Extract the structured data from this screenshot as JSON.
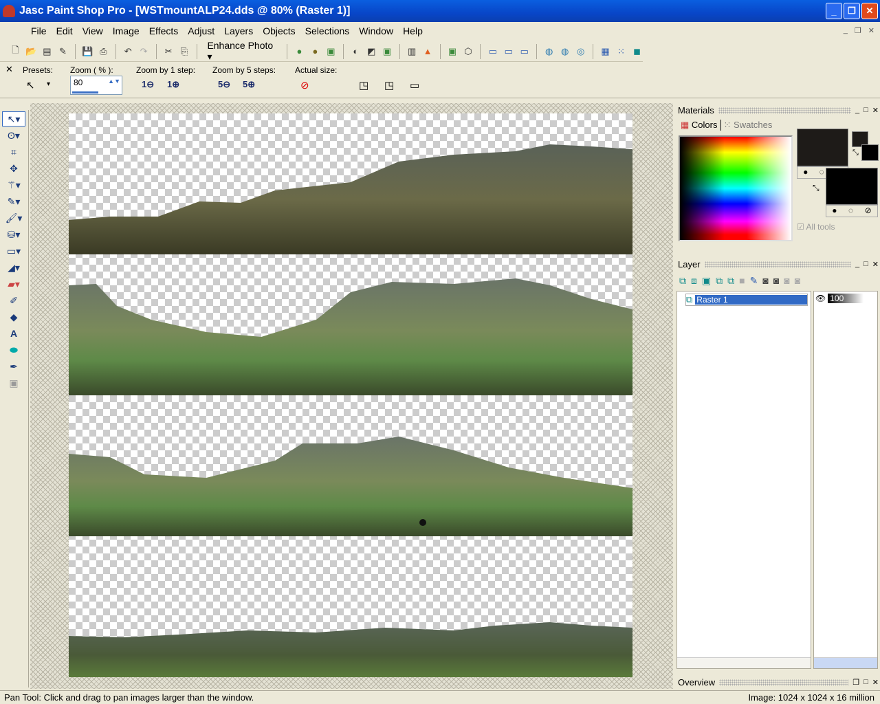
{
  "window": {
    "title": "Jasc Paint Shop Pro - [WSTmountALP24.dds @  80% (Raster 1)]"
  },
  "menu": [
    "File",
    "Edit",
    "View",
    "Image",
    "Effects",
    "Adjust",
    "Layers",
    "Objects",
    "Selections",
    "Window",
    "Help"
  ],
  "toolbar": {
    "enhance_photo": "Enhance Photo"
  },
  "tool_options": {
    "presets": "Presets:",
    "zoom_label": "Zoom ( % ):",
    "zoom_value": "80",
    "zoom1": "Zoom by 1 step:",
    "zoom5": "Zoom by 5 steps:",
    "actual": "Actual size:"
  },
  "materials": {
    "title": "Materials",
    "tab_colors": "Colors",
    "tab_swatches": "Swatches",
    "all_tools": "All tools",
    "foreground": "#1e1b18",
    "background": "#000000"
  },
  "layer": {
    "title": "Layer",
    "layers": [
      {
        "name": "Raster 1",
        "opacity": "100"
      }
    ]
  },
  "overview": {
    "title": "Overview"
  },
  "status": {
    "hint": "Pan Tool: Click and drag to pan images larger than the window.",
    "image_info": "Image:  1024 x 1024 x 16 million"
  }
}
